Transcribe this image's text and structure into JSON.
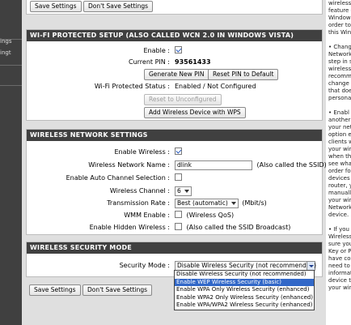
{
  "left_nav": {
    "items": [
      "ings",
      "ingt"
    ]
  },
  "top_buttons": {
    "save": "Save Settings",
    "dont_save": "Don't Save Settings"
  },
  "wps": {
    "title": "WI-FI PROTECTED SETUP (ALSO CALLED WCN 2.0 IN WINDOWS VISTA)",
    "enable_label": "Enable :",
    "current_pin_label": "Current PIN :",
    "current_pin": "93561433",
    "generate_pin": "Generate New PIN",
    "reset_pin_default": "Reset PIN to Default",
    "status_label": "Wi-Fi Protected Status :",
    "status_value": "Enabled / Not Configured",
    "reset_unconfigured": "Reset to Unconfigured",
    "add_wireless": "Add Wireless Device with WPS"
  },
  "wireless": {
    "title": "WIRELESS NETWORK SETTINGS",
    "enable_wireless_label": "Enable Wireless :",
    "network_name_label": "Wireless Network Name :",
    "network_name": "dlink",
    "network_name_hint": "(Also called the SSID)",
    "auto_channel_label": "Enable Auto Channel Selection :",
    "channel_label": "Wireless Channel :",
    "channel": "6",
    "rate_label": "Transmission Rate :",
    "rate": "Best (automatic)",
    "rate_unit": "(Mbit/s)",
    "wmm_label": "WMM Enable :",
    "wmm_hint": "(Wireless QoS)",
    "hidden_label": "Enable Hidden Wireless :",
    "hidden_hint": "(Also called the SSID Broadcast)"
  },
  "security": {
    "title": "WIRELESS SECURITY MODE",
    "mode_label": "Security Mode :",
    "mode_value": "Disable Wireless Security (not recommended)",
    "options": [
      "Disable Wireless Security (not recommended)",
      "Enable WEP Wireless Security (basic)",
      "Enable WPA Only Wireless Security (enhanced)",
      "Enable WPA2 Only Wireless Security (enhanced)",
      "Enable WPA/WPA2 Wireless Security (enhanced)"
    ],
    "highlighted_option": "Enable WEP Wireless Security (basic)"
  },
  "bottom_buttons": {
    "save": "Save Settings",
    "dont_save": "Don't Save Settings"
  },
  "help_column": {
    "lines": [
      "wireless",
      "feature c",
      "Windows",
      "order to",
      "this Windo",
      "",
      "• Chang",
      "Network",
      "step in s",
      "wireless",
      "recomme",
      "change i",
      "that does",
      "personal",
      "",
      "• Enabl",
      "another",
      "your netw",
      "option e",
      "clients w",
      "your wire",
      "when the",
      "see what",
      "order for",
      "devices t",
      "router, y",
      "manually",
      "your wire",
      "Network",
      "device.",
      "",
      "• If you",
      "Wireless",
      "sure you",
      "Key or P",
      "have con",
      "need to",
      "informati",
      "device th",
      "your wire"
    ]
  }
}
